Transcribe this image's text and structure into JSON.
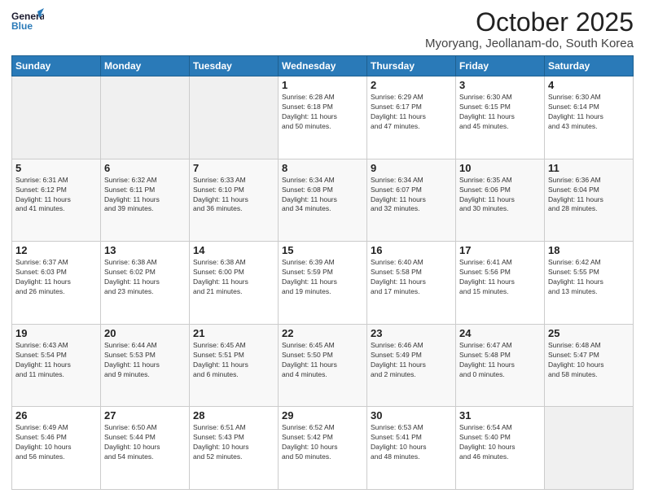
{
  "header": {
    "logo_general": "General",
    "logo_blue": "Blue",
    "main_title": "October 2025",
    "subtitle": "Myoryang, Jeollanam-do, South Korea"
  },
  "weekdays": [
    "Sunday",
    "Monday",
    "Tuesday",
    "Wednesday",
    "Thursday",
    "Friday",
    "Saturday"
  ],
  "weeks": [
    [
      {
        "day": "",
        "info": ""
      },
      {
        "day": "",
        "info": ""
      },
      {
        "day": "",
        "info": ""
      },
      {
        "day": "1",
        "info": "Sunrise: 6:28 AM\nSunset: 6:18 PM\nDaylight: 11 hours\nand 50 minutes."
      },
      {
        "day": "2",
        "info": "Sunrise: 6:29 AM\nSunset: 6:17 PM\nDaylight: 11 hours\nand 47 minutes."
      },
      {
        "day": "3",
        "info": "Sunrise: 6:30 AM\nSunset: 6:15 PM\nDaylight: 11 hours\nand 45 minutes."
      },
      {
        "day": "4",
        "info": "Sunrise: 6:30 AM\nSunset: 6:14 PM\nDaylight: 11 hours\nand 43 minutes."
      }
    ],
    [
      {
        "day": "5",
        "info": "Sunrise: 6:31 AM\nSunset: 6:12 PM\nDaylight: 11 hours\nand 41 minutes."
      },
      {
        "day": "6",
        "info": "Sunrise: 6:32 AM\nSunset: 6:11 PM\nDaylight: 11 hours\nand 39 minutes."
      },
      {
        "day": "7",
        "info": "Sunrise: 6:33 AM\nSunset: 6:10 PM\nDaylight: 11 hours\nand 36 minutes."
      },
      {
        "day": "8",
        "info": "Sunrise: 6:34 AM\nSunset: 6:08 PM\nDaylight: 11 hours\nand 34 minutes."
      },
      {
        "day": "9",
        "info": "Sunrise: 6:34 AM\nSunset: 6:07 PM\nDaylight: 11 hours\nand 32 minutes."
      },
      {
        "day": "10",
        "info": "Sunrise: 6:35 AM\nSunset: 6:06 PM\nDaylight: 11 hours\nand 30 minutes."
      },
      {
        "day": "11",
        "info": "Sunrise: 6:36 AM\nSunset: 6:04 PM\nDaylight: 11 hours\nand 28 minutes."
      }
    ],
    [
      {
        "day": "12",
        "info": "Sunrise: 6:37 AM\nSunset: 6:03 PM\nDaylight: 11 hours\nand 26 minutes."
      },
      {
        "day": "13",
        "info": "Sunrise: 6:38 AM\nSunset: 6:02 PM\nDaylight: 11 hours\nand 23 minutes."
      },
      {
        "day": "14",
        "info": "Sunrise: 6:38 AM\nSunset: 6:00 PM\nDaylight: 11 hours\nand 21 minutes."
      },
      {
        "day": "15",
        "info": "Sunrise: 6:39 AM\nSunset: 5:59 PM\nDaylight: 11 hours\nand 19 minutes."
      },
      {
        "day": "16",
        "info": "Sunrise: 6:40 AM\nSunset: 5:58 PM\nDaylight: 11 hours\nand 17 minutes."
      },
      {
        "day": "17",
        "info": "Sunrise: 6:41 AM\nSunset: 5:56 PM\nDaylight: 11 hours\nand 15 minutes."
      },
      {
        "day": "18",
        "info": "Sunrise: 6:42 AM\nSunset: 5:55 PM\nDaylight: 11 hours\nand 13 minutes."
      }
    ],
    [
      {
        "day": "19",
        "info": "Sunrise: 6:43 AM\nSunset: 5:54 PM\nDaylight: 11 hours\nand 11 minutes."
      },
      {
        "day": "20",
        "info": "Sunrise: 6:44 AM\nSunset: 5:53 PM\nDaylight: 11 hours\nand 9 minutes."
      },
      {
        "day": "21",
        "info": "Sunrise: 6:45 AM\nSunset: 5:51 PM\nDaylight: 11 hours\nand 6 minutes."
      },
      {
        "day": "22",
        "info": "Sunrise: 6:45 AM\nSunset: 5:50 PM\nDaylight: 11 hours\nand 4 minutes."
      },
      {
        "day": "23",
        "info": "Sunrise: 6:46 AM\nSunset: 5:49 PM\nDaylight: 11 hours\nand 2 minutes."
      },
      {
        "day": "24",
        "info": "Sunrise: 6:47 AM\nSunset: 5:48 PM\nDaylight: 11 hours\nand 0 minutes."
      },
      {
        "day": "25",
        "info": "Sunrise: 6:48 AM\nSunset: 5:47 PM\nDaylight: 10 hours\nand 58 minutes."
      }
    ],
    [
      {
        "day": "26",
        "info": "Sunrise: 6:49 AM\nSunset: 5:46 PM\nDaylight: 10 hours\nand 56 minutes."
      },
      {
        "day": "27",
        "info": "Sunrise: 6:50 AM\nSunset: 5:44 PM\nDaylight: 10 hours\nand 54 minutes."
      },
      {
        "day": "28",
        "info": "Sunrise: 6:51 AM\nSunset: 5:43 PM\nDaylight: 10 hours\nand 52 minutes."
      },
      {
        "day": "29",
        "info": "Sunrise: 6:52 AM\nSunset: 5:42 PM\nDaylight: 10 hours\nand 50 minutes."
      },
      {
        "day": "30",
        "info": "Sunrise: 6:53 AM\nSunset: 5:41 PM\nDaylight: 10 hours\nand 48 minutes."
      },
      {
        "day": "31",
        "info": "Sunrise: 6:54 AM\nSunset: 5:40 PM\nDaylight: 10 hours\nand 46 minutes."
      },
      {
        "day": "",
        "info": ""
      }
    ]
  ]
}
